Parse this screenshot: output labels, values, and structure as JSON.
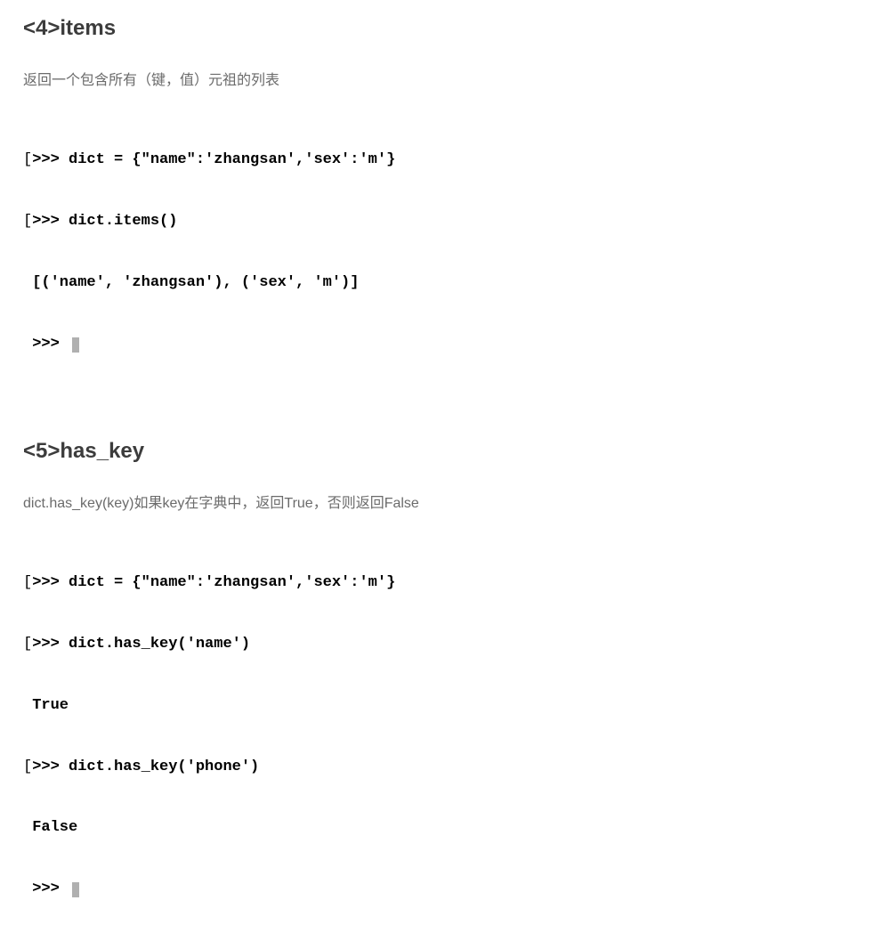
{
  "sections": [
    {
      "heading": "<4>items",
      "description": "返回一个包含所有（键，值）元祖的列表",
      "code_lines": [
        ">>> dict = {\"name\":'zhangsan','sex':'m'}",
        ">>> dict.items()",
        "[('name', 'zhangsan'), ('sex', 'm')]",
        ">>> "
      ],
      "has_leading_bracket": [
        true,
        true,
        false,
        false
      ],
      "has_cursor": [
        false,
        false,
        false,
        true
      ]
    },
    {
      "heading": "<5>has_key",
      "description": "dict.has_key(key)如果key在字典中，返回True，否则返回False",
      "code_lines": [
        ">>> dict = {\"name\":'zhangsan','sex':'m'}",
        ">>> dict.has_key('name')",
        "True",
        ">>> dict.has_key('phone')",
        "False",
        ">>> "
      ],
      "has_leading_bracket": [
        true,
        true,
        false,
        true,
        false,
        false
      ],
      "has_cursor": [
        false,
        false,
        false,
        false,
        false,
        true
      ]
    }
  ]
}
